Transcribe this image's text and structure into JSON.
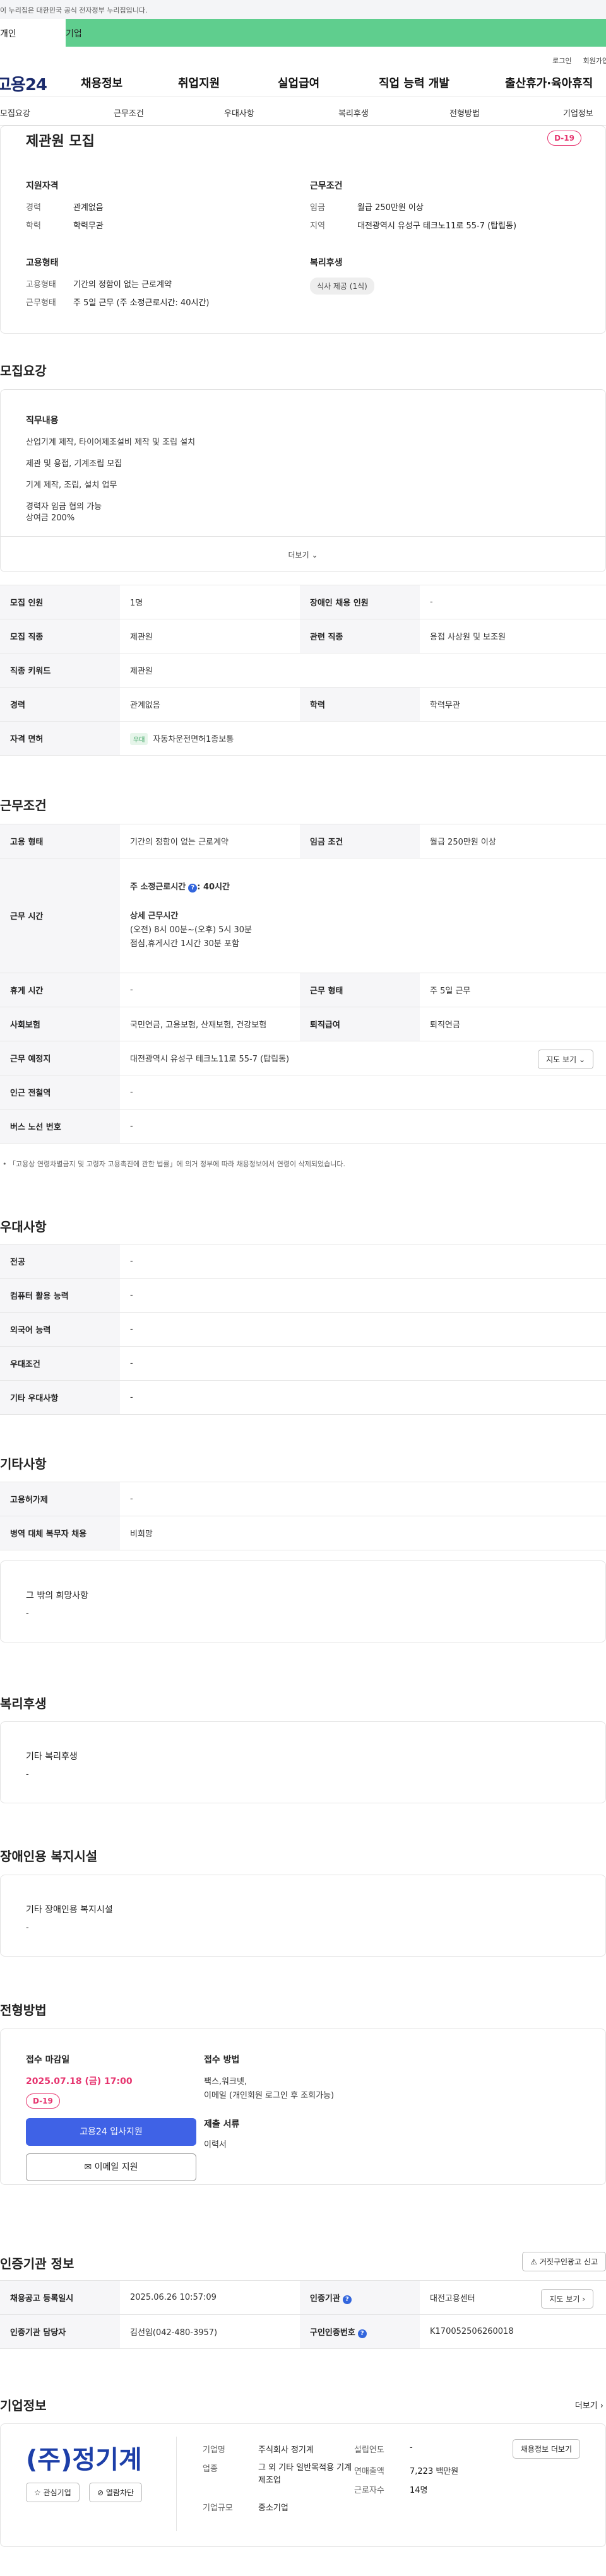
{
  "notice_bar": "이 누리집은 대한민국 공식 전자정부 누리집입니다.",
  "member_tabs": [
    "개인",
    "기업"
  ],
  "util_links": [
    "로그인",
    "회원가입"
  ],
  "logo": "고용24",
  "gnb": [
    "채용정보",
    "취업지원",
    "실업급여",
    "직업 능력 개발",
    "출산휴가·육아휴직"
  ],
  "lnb": [
    "모집요강",
    "근무조건",
    "우대사항",
    "복리후생",
    "전형방법",
    "기업정보"
  ],
  "summary": {
    "title": "제관원 모집",
    "dday": "D-19",
    "qualification_title": "지원자격",
    "qualification": [
      {
        "k": "경력",
        "v": "관계없음"
      },
      {
        "k": "학력",
        "v": "학력무관"
      }
    ],
    "employment_title": "고용형태",
    "employment": [
      {
        "k": "고용형태",
        "v": "기간의 정함이 없는 근로계약"
      },
      {
        "k": "근무형태",
        "v": "주 5일 근무 (주 소정근로시간: 40시간)"
      }
    ],
    "condition_title": "근무조건",
    "condition": [
      {
        "k": "임금",
        "v": "월급 250만원 이상"
      },
      {
        "k": "지역",
        "v": "대전광역시 유성구 테크노11로 55-7 (탑립동)"
      }
    ],
    "welfare_title": "복리후생",
    "welfare_pill": "식사 제공 (1식)"
  },
  "recruit": {
    "title": "모집요강",
    "duty_title": "직무내용",
    "duty_lines": [
      "산업기계 제작, 타이어제조설비 제작 및 조립 설치",
      "제관 및 용접, 기계조립 모집",
      "기계 제작, 조립, 설치 업무",
      "경력자 임금 협의 가능",
      "상여금 200%"
    ],
    "more": "더보기",
    "table": [
      [
        "모집 인원",
        "1명",
        "장애인 채용 인원",
        "-"
      ],
      [
        "모집 직종",
        "제관원",
        "관련 직종",
        "용접 사상원 및 보조원"
      ],
      [
        "직종 키워드",
        "제관원"
      ],
      [
        "경력",
        "관계없음",
        "학력",
        "학력무관"
      ],
      [
        "자격 면허",
        "우대",
        "자동차운전면허1종보통"
      ]
    ]
  },
  "work": {
    "title": "근무조건",
    "employment_k": "고용 형태",
    "employment_v": "기간의 정함이 없는 근로계약",
    "wage_k": "임금 조건",
    "wage_v": "월급 250만원 이상",
    "hours_k": "근무 시간",
    "hours_total": "주 소정근로시간",
    "hours_total_v": ": 40시간",
    "hours_detail_title": "상세 근무시간",
    "hours_detail": "(오전) 8시 00분~(오후) 5시 30분",
    "hours_break": "점심,휴게시간 1시간 30분 포함",
    "rows": [
      [
        "휴게 시간",
        "-",
        "근무 형태",
        "주 5일 근무"
      ],
      [
        "사회보험",
        "국민연금, 고용보험, 산재보험, 건강보험",
        "퇴직급여",
        "퇴직연금"
      ]
    ],
    "location_k": "근무 예정지",
    "location_v": "대전광역시 유성구 테크노11로 55-7 (탑립동)",
    "map_btn": "지도 보기",
    "station_k": "인근 전철역",
    "station_v": "-",
    "bus_k": "버스 노선 번호",
    "bus_v": "-",
    "note": "「고용상 연령차별금지 및 고령자 고용촉진에 관한 법률」에 의거 정부에 따라 채용정보에서 연령이 삭제되었습니다."
  },
  "pref": {
    "title": "우대사항",
    "rows": [
      [
        "전공",
        "-"
      ],
      [
        "컴퓨터 활용 능력",
        "-"
      ],
      [
        "외국어 능력",
        "-"
      ],
      [
        "우대조건",
        "-"
      ],
      [
        "기타 우대사항",
        "-"
      ]
    ]
  },
  "etc": {
    "title": "기타사항",
    "rows": [
      [
        "고용허가제",
        "-"
      ],
      [
        "병역 대체 복무자 채용",
        "비희망"
      ]
    ],
    "box_title": "그 밖의 희망사항",
    "box_v": "-"
  },
  "benefit": {
    "title": "복리후생",
    "box_title": "기타 복리후생",
    "box_v": "-"
  },
  "disabled": {
    "title": "장애인용 복지시설",
    "box_title": "기타 장애인용 복지시설",
    "box_v": "-"
  },
  "apply": {
    "title": "전형방법",
    "deadline_title": "접수 마감일",
    "deadline": "2025.07.18 (금) 17:00",
    "dday": "D-19",
    "apply_btn": "고용24 입사지원",
    "email_btn": "이메일 지원",
    "method_title": "접수 방법",
    "method_lines": [
      "팩스,워크넷,",
      "이메일 (개인회원 로그인 후 조회가능)"
    ],
    "docs_title": "제출 서류",
    "docs": "이력서"
  },
  "cert": {
    "title": "인증기관 정보",
    "report_btn": "거짓구인광고 신고",
    "rows": [
      [
        "채용공고 등록일시",
        "2025.06.26 10:57:09",
        "인증기관",
        "대전고용센터"
      ],
      [
        "인증기관 담당자",
        "김선임(042-480-3957)",
        "구인인증번호",
        "K170052506260018"
      ]
    ],
    "map_btn": "지도 보기"
  },
  "company": {
    "title": "기업정보",
    "more": "더보기",
    "logo_text": "(주)정기계",
    "fav_btn": "관심기업",
    "block_btn": "열람차단",
    "fields": [
      {
        "k": "기업명",
        "v": "주식회사 정기계"
      },
      {
        "k": "업종",
        "v": "그 외 기타 일반목적용 기계 제조업"
      },
      {
        "k": "기업규모",
        "v": "중소기업"
      }
    ],
    "fields2": [
      {
        "k": "설립연도",
        "v": "-"
      },
      {
        "k": "연매출액",
        "v": "7,223 백만원"
      },
      {
        "k": "근로자수",
        "v": "14명"
      }
    ],
    "recruit_btn": "채용정보 더보기"
  }
}
